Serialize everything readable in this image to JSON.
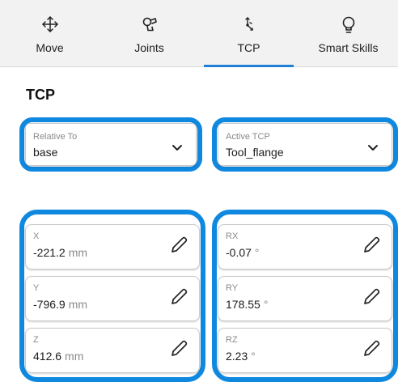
{
  "tabs": [
    {
      "label": "Move",
      "icon": "move-arrows-icon",
      "active": false
    },
    {
      "label": "Joints",
      "icon": "robot-joint-icon",
      "active": false
    },
    {
      "label": "TCP",
      "icon": "tcp-axes-icon",
      "active": true
    },
    {
      "label": "Smart Skills",
      "icon": "lightbulb-icon",
      "active": false
    }
  ],
  "section": {
    "title": "TCP"
  },
  "relative_to": {
    "label": "Relative To",
    "value": "base"
  },
  "active_tcp": {
    "label": "Active TCP",
    "value": "Tool_flange"
  },
  "position": [
    {
      "label": "X",
      "value": "-221.2",
      "unit": "mm"
    },
    {
      "label": "Y",
      "value": "-796.9",
      "unit": "mm"
    },
    {
      "label": "Z",
      "value": "412.6",
      "unit": "mm"
    }
  ],
  "rotation": [
    {
      "label": "RX",
      "value": "-0.07",
      "unit": "°"
    },
    {
      "label": "RY",
      "value": "178.55",
      "unit": "°"
    },
    {
      "label": "RZ",
      "value": "2.23",
      "unit": "°"
    }
  ],
  "colors": {
    "accent": "#1f7fd6",
    "highlight_ring": "#0f88e0"
  }
}
